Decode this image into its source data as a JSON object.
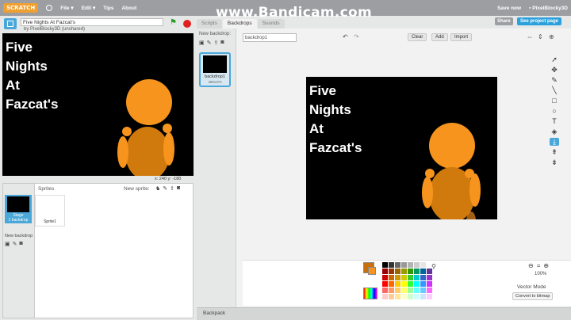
{
  "menubar": {
    "logo": "SCRATCH",
    "items": [
      "File",
      "Edit",
      "Tips",
      "About"
    ],
    "save_status": "Save now",
    "username": "PixelBlocky3D"
  },
  "watermark": "www.Bandicam.com",
  "project": {
    "title": "Five Nights At Fazcat's",
    "byline": "by PixelBlocky3D (unshared)"
  },
  "stage": {
    "lines": [
      "Five",
      "Nights",
      "At",
      "Fazcat's"
    ],
    "coords": "x: 240  y: -180"
  },
  "sprites": {
    "header": "Sprites",
    "new_sprite_label": "New sprite:",
    "stage_thumb": {
      "name": "Stage",
      "sub": "1 backdrop"
    },
    "new_backdrop_label": "New backdrop",
    "items": [
      {
        "name": "Sprite1"
      }
    ]
  },
  "tabs": [
    {
      "label": "Scripts",
      "active": false
    },
    {
      "label": "Backdrops",
      "active": true
    },
    {
      "label": "Sounds",
      "active": false
    }
  ],
  "header_buttons": {
    "share": "Share",
    "see_project_page": "See project page"
  },
  "editor": {
    "new_backdrop_label": "New backdrop:",
    "backdrops": [
      {
        "name": "backdrop1",
        "size": "480x374"
      }
    ],
    "costume_name_value": "backdrop1",
    "buttons": {
      "clear": "Clear",
      "add": "Add",
      "import": "Import"
    },
    "canvas_lines": [
      "Five",
      "Nights",
      "At",
      "Fazcat's"
    ],
    "tools": [
      "paintbrush-icon",
      "line-icon",
      "rectangle-icon",
      "ellipse-icon",
      "text-icon",
      "fill-icon",
      "eraser-icon",
      "select-icon",
      "reshape-icon",
      "pencil-icon"
    ],
    "zoom_percent": "100%",
    "mode_label": "Vector Mode",
    "convert_button": "Convert to bitmap",
    "primary_color": "#c9700d",
    "secondary_color": "#f7941e"
  },
  "backpack_label": "Backpack",
  "palette": [
    "#000000",
    "#333333",
    "#666666",
    "#999999",
    "#b3b3b3",
    "#cccccc",
    "#e6e6e6",
    "#ffffff",
    "#990000",
    "#993300",
    "#996600",
    "#999900",
    "#339900",
    "#009966",
    "#006699",
    "#663399",
    "#cc0000",
    "#cc6600",
    "#cc9900",
    "#cccc00",
    "#33cc33",
    "#00cccc",
    "#3366cc",
    "#9933cc",
    "#ff0000",
    "#ff6600",
    "#ffcc00",
    "#ffff00",
    "#33ff33",
    "#00ffff",
    "#3399ff",
    "#cc33ff",
    "#ff6666",
    "#ff9966",
    "#ffcc66",
    "#ffff66",
    "#99ff99",
    "#66ffff",
    "#66ccff",
    "#ff66ff",
    "#ffcccc",
    "#ffcc99",
    "#ffe699",
    "#ffffcc",
    "#ccffcc",
    "#ccffff",
    "#cce6ff",
    "#ffccff"
  ]
}
